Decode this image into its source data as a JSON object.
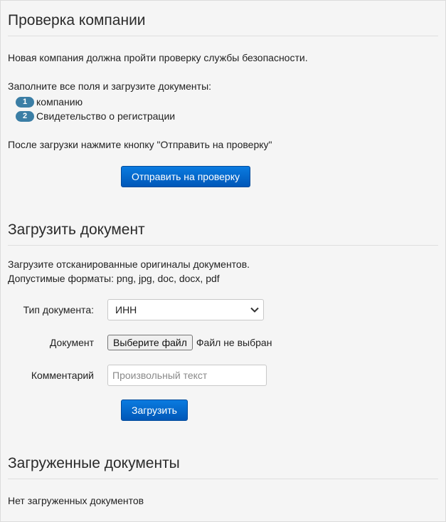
{
  "verify": {
    "title": "Проверка компании",
    "intro": "Новая компания должна пройти проверку службы безопасности.",
    "fill_text": "Заполните все поля и загрузите документы:",
    "steps": [
      {
        "num": "1",
        "label": "компанию"
      },
      {
        "num": "2",
        "label": "Свидетельство о регистрации"
      }
    ],
    "after_text": "После загрузки нажмите кнопку \"Отправить на проверку\"",
    "submit_label": "Отправить на проверку"
  },
  "upload": {
    "title": "Загрузить документ",
    "desc_line1": "Загрузите отсканированные оригиналы документов.",
    "desc_line2": "Допустимые форматы: png, jpg, doc, docx, pdf",
    "doc_type_label": "Тип документа:",
    "doc_type_value": "ИНН",
    "document_label": "Документ",
    "file_button": "Выберите файл",
    "file_status": "Файл не выбран",
    "comment_label": "Комментарий",
    "comment_placeholder": "Произвольный текст",
    "upload_button": "Загрузить"
  },
  "uploaded": {
    "title": "Загруженные документы",
    "empty_text": "Нет загруженных документов"
  },
  "colors": {
    "accent": "#0a6fd6",
    "badge": "#3b7ea5",
    "background": "#f5f5f5"
  }
}
